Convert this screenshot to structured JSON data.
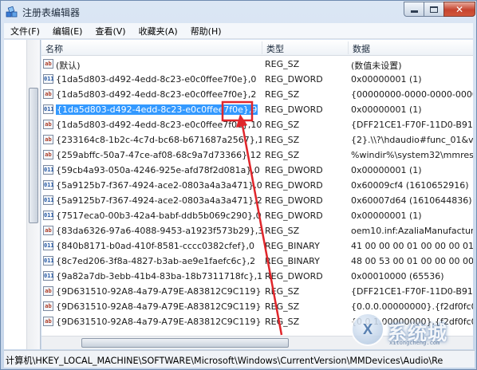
{
  "window": {
    "title": "注册表编辑器",
    "close_glyph": "✕"
  },
  "menu": [
    "文件(F)",
    "编辑(E)",
    "查看(V)",
    "收藏夹(A)",
    "帮助(H)"
  ],
  "columns": {
    "name": "名称",
    "type": "类型",
    "data": "数据"
  },
  "rows": [
    {
      "icon": "string-value-icon",
      "icon_text": "ab",
      "name": "(默认)",
      "type": "REG_SZ",
      "data": "(数值未设置)"
    },
    {
      "icon": "binary-value-icon",
      "icon_text": "011",
      "name": "{1da5d803-d492-4edd-8c23-e0c0ffee7f0e},0",
      "type": "REG_DWORD",
      "data": "0x00000001 (1)"
    },
    {
      "icon": "string-value-icon",
      "icon_text": "ab",
      "name": "{1da5d803-d492-4edd-8c23-e0c0ffee7f0e},2",
      "type": "REG_SZ",
      "data": "{00000000-0000-0000-0000"
    },
    {
      "icon": "binary-value-icon",
      "icon_text": "011",
      "name": "{1da5d803-d492-4edd-8c23-e0c0ffee7f0e},9",
      "type": "REG_DWORD",
      "data": "0x00000001 (1)",
      "selected": true
    },
    {
      "icon": "string-value-icon",
      "icon_text": "ab",
      "name": "{1da5d803-d492-4edd-8c23-e0c0ffee7f0e},10",
      "type": "REG_SZ",
      "data": "{DFF21CE1-F70F-11D0-B917"
    },
    {
      "icon": "string-value-icon",
      "icon_text": "ab",
      "name": "{233164c8-1b2c-4c7d-bc68-b671687a2567},1",
      "type": "REG_SZ",
      "data": "{2}.\\\\?\\hdaudio#func_01&ve"
    },
    {
      "icon": "string-value-icon",
      "icon_text": "ab",
      "name": "{259abffc-50a7-47ce-af08-68c9a7d73366},12",
      "type": "REG_SZ",
      "data": "%windir%\\system32\\mmres"
    },
    {
      "icon": "binary-value-icon",
      "icon_text": "011",
      "name": "{59cb4a93-050a-4246-925e-afd78f2d081a},0",
      "type": "REG_DWORD",
      "data": "0x00000001 (1)"
    },
    {
      "icon": "binary-value-icon",
      "icon_text": "011",
      "name": "{5a9125b7-f367-4924-ace2-0803a4a3a471},0",
      "type": "REG_DWORD",
      "data": "0x60009cf4 (1610652916)"
    },
    {
      "icon": "binary-value-icon",
      "icon_text": "011",
      "name": "{5a9125b7-f367-4924-ace2-0803a4a3a471},2",
      "type": "REG_DWORD",
      "data": "0x60007d64 (1610644836)"
    },
    {
      "icon": "binary-value-icon",
      "icon_text": "011",
      "name": "{7517eca0-00b3-42a4-babf-ddb5b069c290},0",
      "type": "REG_DWORD",
      "data": "0x00000001 (1)"
    },
    {
      "icon": "string-value-icon",
      "icon_text": "ab",
      "name": "{83da6326-97a6-4088-9453-a1923f573b29},3",
      "type": "REG_SZ",
      "data": "oem10.inf:AzaliaManufactur"
    },
    {
      "icon": "binary-value-icon",
      "icon_text": "011",
      "name": "{840b8171-b0ad-410f-8581-cccc0382cfef},0",
      "type": "REG_BINARY",
      "data": "41 00 00 00 01 00 00 00 01"
    },
    {
      "icon": "binary-value-icon",
      "icon_text": "011",
      "name": "{8c7ed206-3f8a-4827-b3ab-ae9e1faefc6c},2",
      "type": "REG_BINARY",
      "data": "48 00 53 00 01 00 00 00 00"
    },
    {
      "icon": "binary-value-icon",
      "icon_text": "011",
      "name": "{9a82a7db-3ebb-41b4-83ba-18b7311718fc},1",
      "type": "REG_DWORD",
      "data": "0x00010000 (65536)"
    },
    {
      "icon": "string-value-icon",
      "icon_text": "ab",
      "name": "{9D631510-92A8-4a79-A79E-A83812C9C119},0",
      "type": "REG_SZ",
      "data": "{DFF21CE1-F70F-11D0-B917"
    },
    {
      "icon": "string-value-icon",
      "icon_text": "ab",
      "name": "{9D631510-92A8-4a79-A79E-A83812C9C119},1",
      "type": "REG_SZ",
      "data": "{0.0.0.00000000}.{f2df0fc0-0"
    },
    {
      "icon": "string-value-icon",
      "icon_text": "ab",
      "name": "{9D631510-92A8-4a79-A79E-A83812C9C119},2",
      "type": "REG_SZ",
      "data": "{0.0.1.00000000}.{f2df0fc0-0"
    }
  ],
  "status_path": "计算机\\HKEY_LOCAL_MACHINE\\SOFTWARE\\Microsoft\\Windows\\CurrentVersion\\MMDevices\\Audio\\Re",
  "watermark": {
    "text": "系统城",
    "sub": "xitongcheng.com",
    "glyph": "X"
  },
  "colors": {
    "selection": "#3399ff",
    "annotation": "#e0262b"
  }
}
